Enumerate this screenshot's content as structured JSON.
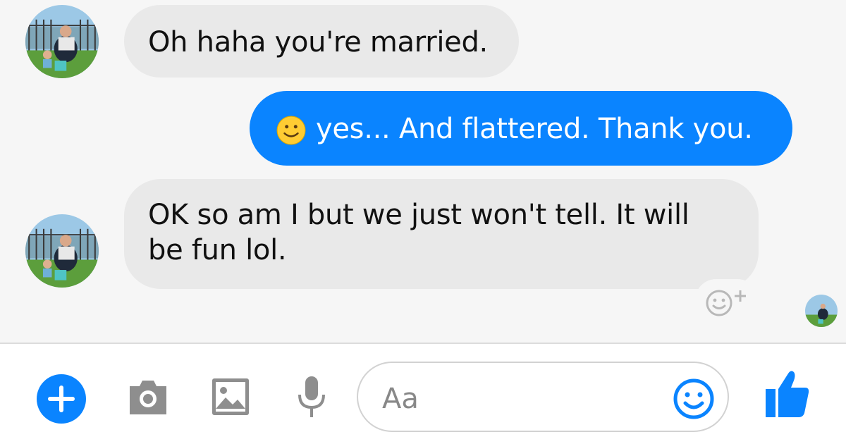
{
  "messages": [
    {
      "sender": "contact",
      "text": "Oh haha you're married."
    },
    {
      "sender": "me",
      "emoji": "slight-smile",
      "text": "yes... And flattered. Thank you."
    },
    {
      "sender": "contact",
      "text": "OK so am I but we just won't tell. It will be fun lol."
    }
  ],
  "composer": {
    "placeholder": "Aa"
  },
  "icons": {
    "more": "plus-icon",
    "camera": "camera-icon",
    "gallery": "image-icon",
    "voice": "microphone-icon",
    "emoji": "smiley-icon",
    "like": "thumbs-up-icon",
    "reaction": "add-reaction-icon"
  },
  "colors": {
    "accent": "#0a84ff",
    "incoming_bubble": "#e9e9e9",
    "icon_gray": "#8e8e8e"
  }
}
